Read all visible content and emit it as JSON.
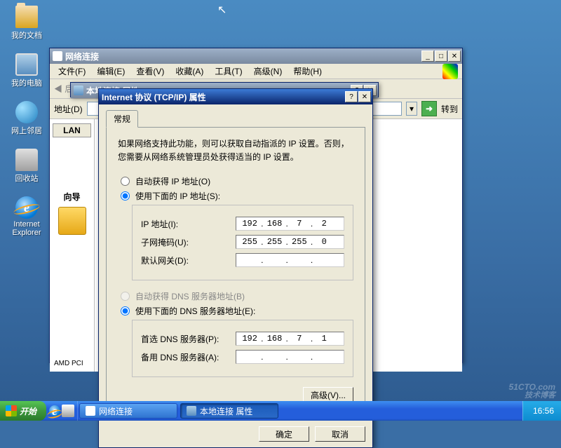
{
  "desktop": {
    "icons": [
      "我的文档",
      "我的电脑",
      "网上邻居",
      "回收站",
      "Internet Explorer"
    ]
  },
  "win_parent": {
    "title": "网络连接",
    "menus": [
      "文件(F)",
      "编辑(E)",
      "查看(V)",
      "收藏(A)",
      "工具(T)",
      "高级(N)",
      "帮助(H)"
    ],
    "addr_label": "地址(D)",
    "go_label": "转到",
    "left_header": "LAN",
    "wizard_label": "向导",
    "device_text": "AMD PCI"
  },
  "win_child": {
    "title": "本地连接 属性"
  },
  "dialog": {
    "title": "Internet 协议 (TCP/IP) 属性",
    "tab": "常规",
    "desc": "如果网络支持此功能，则可以获取自动指派的 IP 设置。否则，您需要从网络系统管理员处获得适当的 IP 设置。",
    "radio_auto_ip": "自动获得 IP 地址(O)",
    "radio_manual_ip": "使用下面的 IP 地址(S):",
    "ip_label": "IP 地址(I):",
    "ip_value": [
      "192",
      "168",
      "7",
      "2"
    ],
    "mask_label": "子网掩码(U):",
    "mask_value": [
      "255",
      "255",
      "255",
      "0"
    ],
    "gw_label": "默认网关(D):",
    "gw_value": [
      "",
      "",
      "",
      ""
    ],
    "radio_auto_dns": "自动获得 DNS 服务器地址(B)",
    "radio_manual_dns": "使用下面的 DNS 服务器地址(E):",
    "dns1_label": "首选 DNS 服务器(P):",
    "dns1_value": [
      "192",
      "168",
      "7",
      "1"
    ],
    "dns2_label": "备用 DNS 服务器(A):",
    "dns2_value": [
      "",
      "",
      "",
      ""
    ],
    "advanced": "高级(V)...",
    "ok": "确定",
    "cancel": "取消"
  },
  "taskbar": {
    "start": "开始",
    "tasks": [
      "网络连接",
      "本地连接 属性"
    ],
    "clock": "16:56"
  },
  "watermark": {
    "main": "51CTO.com",
    "sub": "技术博客"
  }
}
